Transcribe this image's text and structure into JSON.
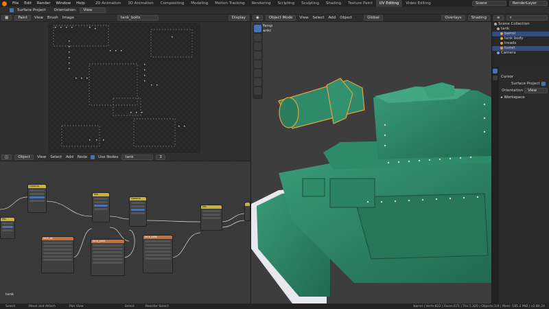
{
  "topbar": {
    "menus": [
      "File",
      "Edit",
      "Render",
      "Window",
      "Help"
    ],
    "workspaces": [
      "2D Animation",
      "3D Animation",
      "Compositing",
      "Modeling",
      "Motion Tracking",
      "Rendering",
      "Scripting",
      "Sculpting",
      "Shading",
      "Texture Paint",
      "UV Editing",
      "Video Editing"
    ],
    "active_workspace": "UV Editing",
    "scene_label": "Scene",
    "layer_label": "RenderLayer"
  },
  "toolsettings": {
    "surface_project": "Surface Project",
    "orientation_label": "Orientation:",
    "orientation_value": "View"
  },
  "image_editor": {
    "mode": "Paint",
    "menus": [
      "View",
      "Brush",
      "Image"
    ],
    "image_name": "tank_bolts",
    "display": "Display"
  },
  "node_editor": {
    "type": "Object",
    "menus": [
      "View",
      "Select",
      "Add",
      "Node"
    ],
    "use_nodes": "Use Nodes",
    "material": "tank",
    "users": "3",
    "footer_label": "tank",
    "nodes": [
      {
        "title": "Gamma",
        "kind": "mix"
      },
      {
        "title": "Mix",
        "kind": "mix"
      },
      {
        "title": "Mix",
        "kind": "mix"
      },
      {
        "title": "Gamma",
        "kind": "mix"
      },
      {
        "title": "Mix",
        "kind": "mix"
      },
      {
        "title": "tank_ao",
        "kind": "tex"
      },
      {
        "title": "tank_paint",
        "kind": "tex"
      },
      {
        "title": "tank_bolts",
        "kind": "tex"
      }
    ]
  },
  "viewport": {
    "mode": "Object Mode",
    "menus": [
      "View",
      "Select",
      "Add",
      "Object"
    ],
    "transform": "Global",
    "overlays": "Overlays",
    "shading": "Shading",
    "view_name": "User Persp",
    "object_info": "(65) tankl"
  },
  "outliner": {
    "search_placeholder": "",
    "items": [
      {
        "label": "Scene Collection",
        "color": "#aaaaaa",
        "selected": false
      },
      {
        "label": "tank",
        "color": "#aaaaaa",
        "selected": false
      },
      {
        "label": "barrel",
        "color": "#e8a33a",
        "selected": true
      },
      {
        "label": "tank body",
        "color": "#e8a33a",
        "selected": false
      },
      {
        "label": "treads",
        "color": "#e8a33a",
        "selected": false
      },
      {
        "label": "turret",
        "color": "#e8a33a",
        "selected": true
      },
      {
        "label": "Camera",
        "color": "#7ca0d8",
        "selected": false
      }
    ]
  },
  "properties": {
    "title": "Cursor",
    "surface_project": "Surface Project",
    "orientation_label": "Orientation",
    "orientation_value": "View",
    "workspace": "Workspace"
  },
  "statusbar": {
    "items": [
      "Select",
      "Move and Attach",
      "Pan View",
      "Select",
      "Reorder Select"
    ],
    "stats": "barrel | Verts:822 | Faces:671 | Tris:1,320 | Objects:1/4 | Mem: 185.2 MiB | v2.80.24"
  },
  "colors": {
    "accent": "#4772b3",
    "selected_outline": "#e8a33a",
    "tank_green": "#2f8a6a"
  }
}
